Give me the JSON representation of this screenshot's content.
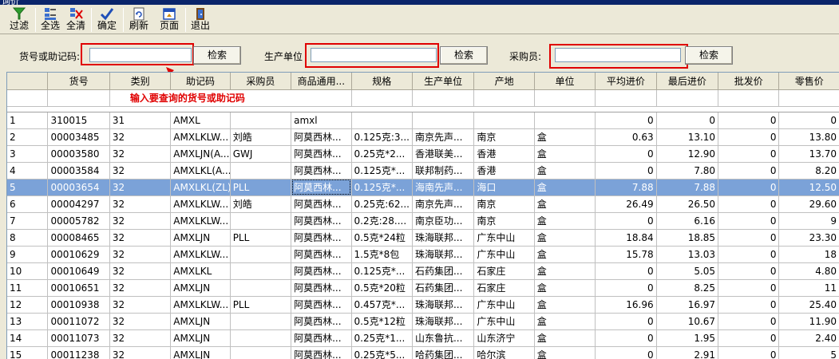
{
  "window": {
    "title": "询价"
  },
  "toolbar": {
    "buttons": [
      {
        "label": "过滤"
      },
      {
        "label": "全选"
      },
      {
        "label": "全清"
      },
      {
        "label": "确定"
      },
      {
        "label": "刷新"
      },
      {
        "label": "页面"
      },
      {
        "label": "退出"
      }
    ]
  },
  "search": {
    "code_label": "货号或助记码:",
    "code_value": "",
    "code_button": "检索",
    "maker_label": "生产单位",
    "maker_value": "",
    "maker_button": "检索",
    "buyer_label": "采购员:",
    "buyer_value": "",
    "buyer_button": "检索",
    "hint": "输入要查询的货号或助记码"
  },
  "table": {
    "columns": [
      "",
      "货号",
      "类别",
      "助记码",
      "采购员",
      "商品通用...",
      "规格",
      "生产单位",
      "产地",
      "单位",
      "平均进价",
      "最后进价",
      "批发价",
      "零售价"
    ],
    "rows": [
      [
        "1",
        "310015",
        "31",
        "AMXL",
        "",
        "amxl",
        "",
        "",
        "",
        "",
        "0",
        "0",
        "0",
        "0"
      ],
      [
        "2",
        "00003485",
        "32",
        "AMXLKLW...",
        "刘皓",
        "阿莫西林...",
        "0.125克:3...",
        "南京先声...",
        "南京",
        "盒",
        "0.63",
        "13.10",
        "0",
        "13.80"
      ],
      [
        "3",
        "00003580",
        "32",
        "AMXLJN(A...",
        "GWJ",
        "阿莫西林...",
        "0.25克*2...",
        "香港联美...",
        "香港",
        "盒",
        "0",
        "12.90",
        "0",
        "13.70"
      ],
      [
        "4",
        "00003584",
        "32",
        "AMXLKL(A...",
        "",
        "阿莫西林...",
        "0.125克*...",
        "联邦制药...",
        "香港",
        "盒",
        "0",
        "7.80",
        "0",
        "8.20"
      ],
      [
        "5",
        "00003654",
        "32",
        "AMXLKL(ZL)",
        "PLL",
        "阿莫西林...",
        "0.125克*...",
        "海南先声...",
        "海口",
        "盒",
        "7.88",
        "7.88",
        "0",
        "12.50"
      ],
      [
        "6",
        "00004297",
        "32",
        "AMXLKLW...",
        "刘皓",
        "阿莫西林...",
        "0.25克:62...",
        "南京先声...",
        "南京",
        "盒",
        "26.49",
        "26.50",
        "0",
        "29.60"
      ],
      [
        "7",
        "00005782",
        "32",
        "AMXLKLW...",
        "",
        "阿莫西林...",
        "0.2克:28....",
        "南京臣功...",
        "南京",
        "盒",
        "0",
        "6.16",
        "0",
        "9"
      ],
      [
        "8",
        "00008465",
        "32",
        "AMXLJN",
        "PLL",
        "阿莫西林...",
        "0.5克*24粒",
        "珠海联邦...",
        "广东中山",
        "盒",
        "18.84",
        "18.85",
        "0",
        "23.30"
      ],
      [
        "9",
        "00010629",
        "32",
        "AMXLKLW...",
        "",
        "阿莫西林...",
        "1.5克*8包",
        "珠海联邦...",
        "广东中山",
        "盒",
        "15.78",
        "13.03",
        "0",
        "18"
      ],
      [
        "10",
        "00010649",
        "32",
        "AMXLKL",
        "",
        "阿莫西林...",
        "0.125克*...",
        "石药集团...",
        "石家庄",
        "盒",
        "0",
        "5.05",
        "0",
        "4.80"
      ],
      [
        "11",
        "00010651",
        "32",
        "AMXLJN",
        "",
        "阿莫西林...",
        "0.5克*20粒",
        "石药集团...",
        "石家庄",
        "盒",
        "0",
        "8.25",
        "0",
        "11"
      ],
      [
        "12",
        "00010938",
        "32",
        "AMXLKLW...",
        "PLL",
        "阿莫西林...",
        "0.457克*...",
        "珠海联邦...",
        "广东中山",
        "盒",
        "16.96",
        "16.97",
        "0",
        "25.40"
      ],
      [
        "13",
        "00011072",
        "32",
        "AMXLJN",
        "",
        "阿莫西林...",
        "0.5克*12粒",
        "珠海联邦...",
        "广东中山",
        "盒",
        "0",
        "10.67",
        "0",
        "11.90"
      ],
      [
        "14",
        "00011073",
        "32",
        "AMXLJN",
        "",
        "阿莫西林...",
        "0.25克*1...",
        "山东鲁抗...",
        "山东济宁",
        "盒",
        "0",
        "1.95",
        "0",
        "2.40"
      ],
      [
        "15",
        "00011238",
        "32",
        "AMXLJN",
        "",
        "阿莫西林...",
        "0.25克*5...",
        "哈药集团...",
        "哈尔滨",
        "盒",
        "0",
        "2.91",
        "0",
        "5"
      ]
    ],
    "selected_row": 4
  },
  "colors": {
    "accent_red": "#e00000",
    "selection": "#7ba2d8",
    "titlebar": "#0a246a"
  },
  "icons": [
    "filter-icon",
    "select-all-icon",
    "clear-all-icon",
    "confirm-icon",
    "refresh-icon",
    "page-icon",
    "exit-icon"
  ]
}
